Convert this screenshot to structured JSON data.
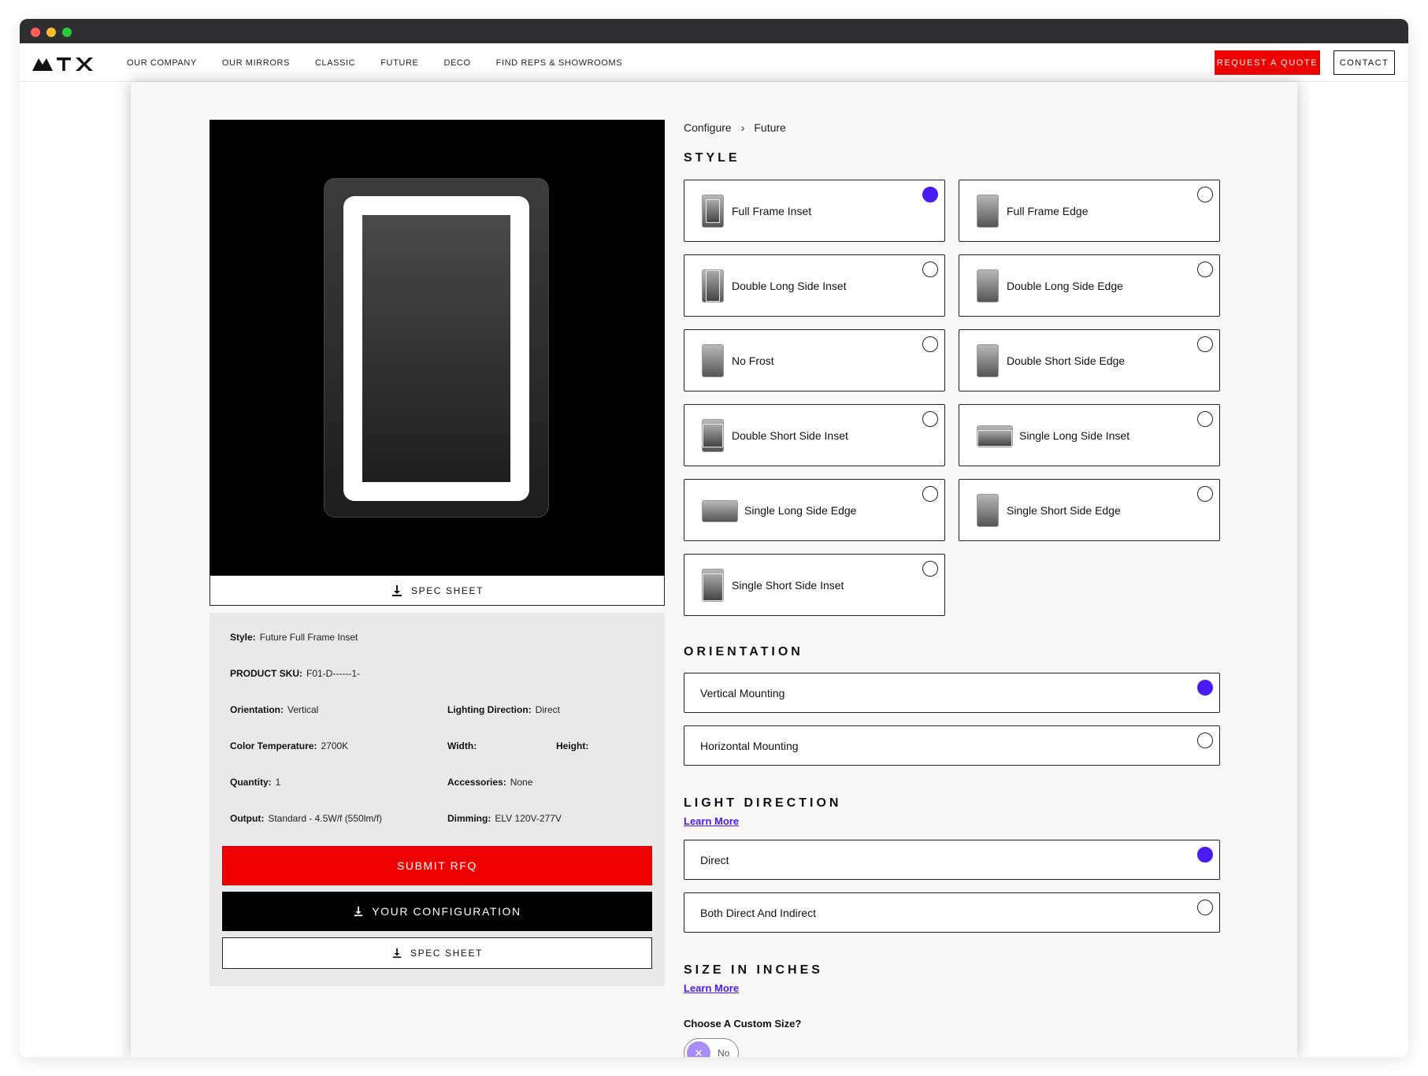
{
  "nav": {
    "links": [
      "OUR COMPANY",
      "OUR MIRRORS",
      "CLASSIC",
      "FUTURE",
      "DECO",
      "FIND REPS & SHOWROOMS"
    ],
    "quote_label": "REQUEST A QUOTE",
    "contact_label": "CONTACT",
    "brand_color": "#ee0000"
  },
  "preview": {
    "spec_sheet_label": "SPEC SHEET"
  },
  "summary": {
    "style": {
      "label": "Style:",
      "value": "Future Full Frame Inset"
    },
    "sku": {
      "label": "PRODUCT SKU:",
      "value": "F01-D------1-"
    },
    "orientation": {
      "label": "Orientation:",
      "value": "Vertical"
    },
    "lighting_direction": {
      "label": "Lighting Direction:",
      "value": "Direct"
    },
    "color_temperature": {
      "label": "Color Temperature:",
      "value": "2700K"
    },
    "width": {
      "label": "Width:",
      "value": ""
    },
    "height": {
      "label": "Height:",
      "value": ""
    },
    "quantity": {
      "label": "Quantity:",
      "value": "1"
    },
    "accessories": {
      "label": "Accessories:",
      "value": "None"
    },
    "output": {
      "label": "Output:",
      "value": "Standard - 4.5W/f (550lm/f)"
    },
    "dimming": {
      "label": "Dimming:",
      "value": "ELV 120V-277V"
    },
    "submit_label": "SUBMIT RFQ",
    "config_label": "YOUR CONFIGURATION",
    "spec_sheet_label": "SPEC SHEET"
  },
  "breadcrumb": {
    "root": "Configure",
    "current": "Future"
  },
  "style": {
    "title": "STYLE",
    "selected_color": "#4a1bf5",
    "options": [
      {
        "label": "Full Frame Inset",
        "selected": true
      },
      {
        "label": "Full Frame Edge",
        "selected": false
      },
      {
        "label": "Double Long Side Inset",
        "selected": false
      },
      {
        "label": "Double Long Side Edge",
        "selected": false
      },
      {
        "label": "No Frost",
        "selected": false
      },
      {
        "label": "Double Short Side Edge",
        "selected": false
      },
      {
        "label": "Double Short Side Inset",
        "selected": false
      },
      {
        "label": "Single Long Side Inset",
        "selected": false
      },
      {
        "label": "Single Long Side Edge",
        "selected": false
      },
      {
        "label": "Single Short Side Edge",
        "selected": false
      },
      {
        "label": "Single Short Side Inset",
        "selected": false
      }
    ]
  },
  "orientation": {
    "title": "ORIENTATION",
    "options": [
      {
        "label": "Vertical Mounting",
        "selected": true
      },
      {
        "label": "Horizontal Mounting",
        "selected": false
      }
    ]
  },
  "light_direction": {
    "title": "LIGHT DIRECTION",
    "learn_more": "Learn More",
    "options": [
      {
        "label": "Direct",
        "selected": true
      },
      {
        "label": "Both Direct And Indirect",
        "selected": false
      }
    ]
  },
  "size": {
    "title": "SIZE IN INCHES",
    "learn_more": "Learn More",
    "custom_question": "Choose A Custom Size?",
    "toggle_label": "No",
    "toggle_on": false
  }
}
